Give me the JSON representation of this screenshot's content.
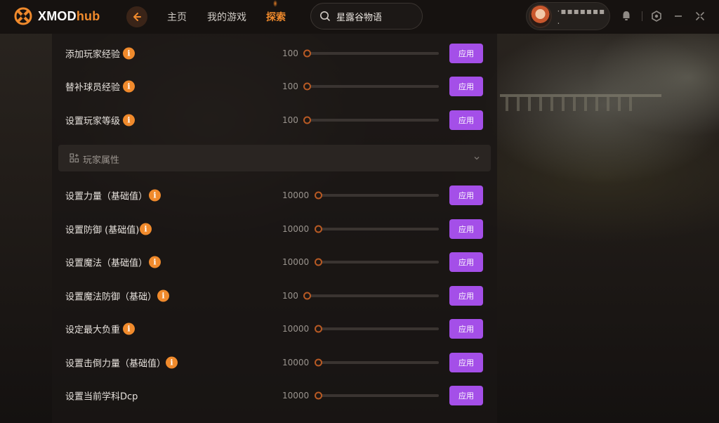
{
  "app": {
    "logo_text": "XMOD",
    "logo_hub": "hub"
  },
  "nav": {
    "items": [
      {
        "label": "主页",
        "active": false
      },
      {
        "label": "我的游戏",
        "active": false
      },
      {
        "label": "探索",
        "active": true
      }
    ],
    "accent_color": "#f08a2c"
  },
  "search": {
    "value": "星露谷物语"
  },
  "user": {
    "name": "·▪▪▪▪▪▪▪ ."
  },
  "window_controls": [
    "notification-icon",
    "settings-icon",
    "minimize-icon",
    "collapse-icon"
  ],
  "cheats_top": [
    {
      "label": "添加玩家经验",
      "value": "100",
      "button": "应用"
    },
    {
      "label": "替补球员经验",
      "value": "100",
      "button": "应用"
    },
    {
      "label": "设置玩家等级",
      "value": "100",
      "button": "应用"
    }
  ],
  "section": {
    "label": "玩家属性",
    "icon": "grid-icon"
  },
  "cheats_attr": [
    {
      "label": "设置力量（基础值）",
      "value": "10000",
      "button": "应用",
      "info": true
    },
    {
      "label": "设置防御 (基础值)",
      "value": "10000",
      "button": "应用",
      "info": true
    },
    {
      "label": "设置魔法（基础值）",
      "value": "10000",
      "button": "应用",
      "info": true
    },
    {
      "label": "设置魔法防御（基础）",
      "value": "100",
      "button": "应用",
      "info": true
    },
    {
      "label": "设定最大负重",
      "value": "10000",
      "button": "应用",
      "info": true
    },
    {
      "label": "设置击倒力量（基础值）",
      "value": "10000",
      "button": "应用",
      "info": true
    },
    {
      "label": "设置当前学科Dcp",
      "value": "10000",
      "button": "应用",
      "info": false
    }
  ],
  "colors": {
    "apply_button": "#a44fe8",
    "info_badge": "#f08a2c",
    "slider_thumb": "#b85a24"
  }
}
